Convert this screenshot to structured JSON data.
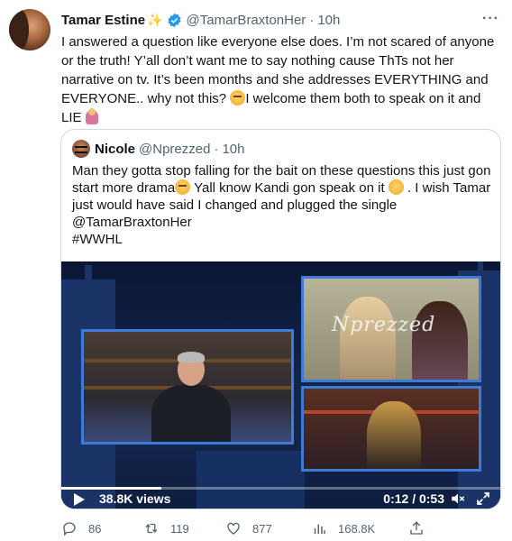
{
  "author": {
    "name": "Tamar Estine",
    "handle": "@TamarBraxtonHer",
    "time": "10h",
    "separator": "·"
  },
  "tweet": {
    "text_part1": "I answered a question like everyone else does. I’m not scared of anyone or the truth! Y’all don’t want me to say nothing cause ThTs not her narrative on tv. It’s been months and she addresses EVERYTHING and EVERYONE.. why not this? ",
    "text_part2": "I welcome them both to speak on it and LIE "
  },
  "quote": {
    "name": "Nicole",
    "handle": "@Nprezzed",
    "time": "10h",
    "separator": "·",
    "text_part1": "Man they gotta stop falling for the bait on these questions this just gon start more drama",
    "text_part2": "  Yall know Kandi gon speak on it ",
    "text_part3": " . I wish Tamar just would have said I changed and  plugged the single @TamarBraxtonHer",
    "hashtag": "#WWHL"
  },
  "video": {
    "views": "38.8K views",
    "time": "0:12 / 0:53",
    "watermark": "Nprezzed",
    "progress": 0.226
  },
  "actions": {
    "replies": "86",
    "reposts": "119",
    "likes": "877",
    "views": "168.8K"
  },
  "colors": {
    "verified": "#1d9bf0",
    "secondary_text": "#536471",
    "border": "#cfd9de",
    "video_frame": "#3f7bd6"
  },
  "icons": [
    "verified-badge-icon",
    "more-icon",
    "sparkle-icon",
    "play-icon",
    "mute-icon",
    "fullscreen-icon",
    "reply-icon",
    "repost-icon",
    "like-icon",
    "views-chart-icon",
    "share-icon"
  ]
}
